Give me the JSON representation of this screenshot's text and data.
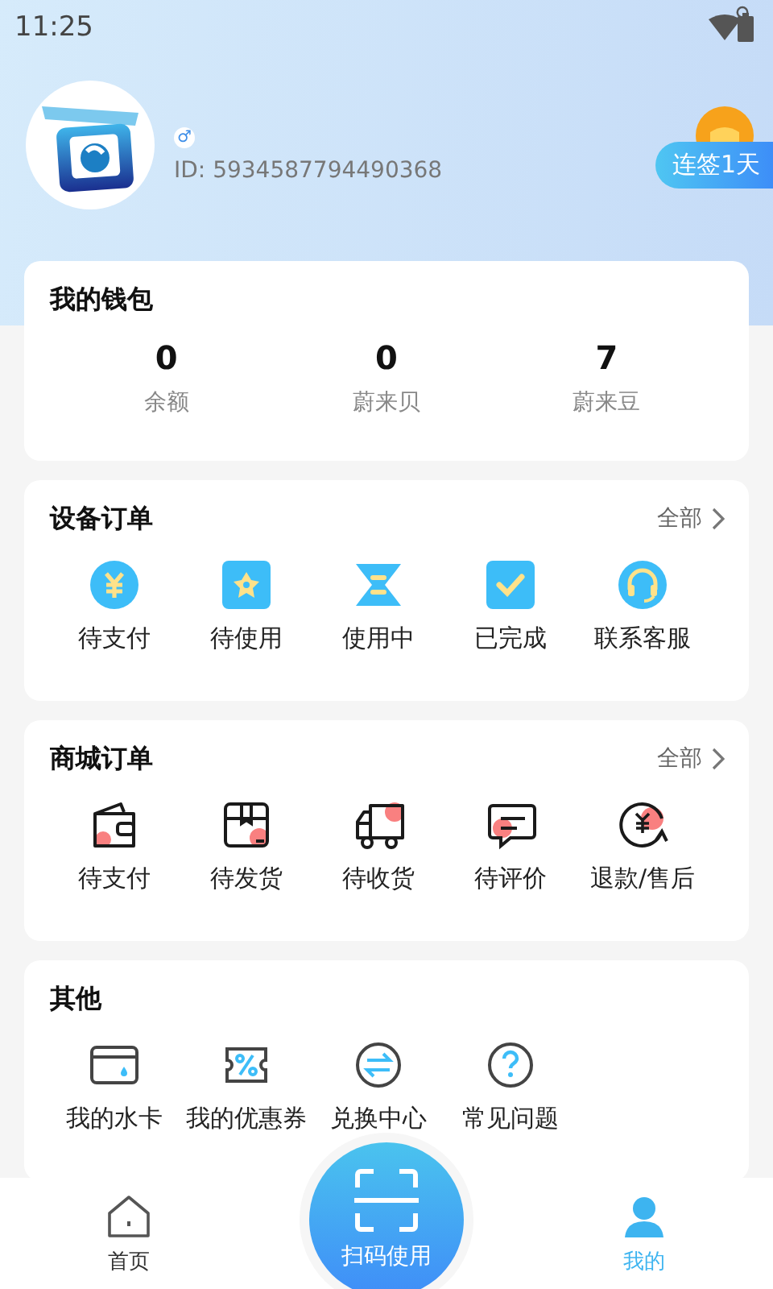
{
  "status_bar": {
    "time": "11:25"
  },
  "profile": {
    "gender_symbol": "♂",
    "user_id": "ID: 5934587794490368",
    "checkin_badge": "连签1天"
  },
  "wallet": {
    "title": "我的钱包",
    "stats": [
      {
        "value": "0",
        "label": "余额"
      },
      {
        "value": "0",
        "label": "蔚来贝"
      },
      {
        "value": "7",
        "label": "蔚来豆"
      }
    ]
  },
  "sections": [
    {
      "kind": "device",
      "title": "设备订单",
      "all_link": "全部",
      "items": [
        {
          "label": "待支付"
        },
        {
          "label": "待使用"
        },
        {
          "label": "使用中"
        },
        {
          "label": "已完成"
        },
        {
          "label": "联系客服"
        }
      ]
    },
    {
      "kind": "mall",
      "title": "商城订单",
      "all_link": "全部",
      "items": [
        {
          "label": "待支付"
        },
        {
          "label": "待发货"
        },
        {
          "label": "待收货"
        },
        {
          "label": "待评价"
        },
        {
          "label": "退款/售后"
        }
      ]
    },
    {
      "kind": "other",
      "title": "其他",
      "items": [
        {
          "label": "我的水卡"
        },
        {
          "label": "我的优惠券"
        },
        {
          "label": "兑换中心"
        },
        {
          "label": "常见问题"
        }
      ]
    }
  ],
  "scan_button": {
    "label": "扫码使用"
  },
  "tab_bar": {
    "tabs": [
      {
        "label": "首页",
        "selected": false
      },
      {
        "label": "我的",
        "selected": true
      }
    ]
  }
}
